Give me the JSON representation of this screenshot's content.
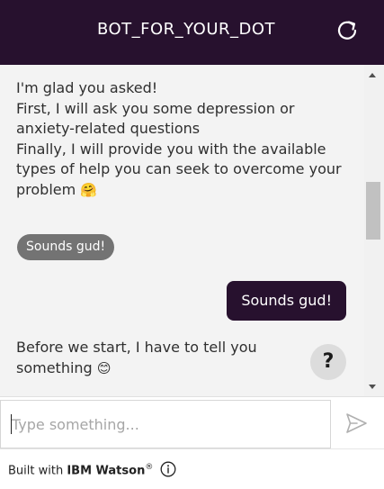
{
  "header": {
    "title": "BOT_FOR_YOUR_DOT",
    "restart_icon": "restart-icon"
  },
  "messages": {
    "bot_intro": {
      "line1": "I'm glad you asked!",
      "line2": "First, I will ask you some depression or",
      "line3": "anxiety-related questions",
      "line4": "Finally, I will provide you with the available",
      "line5": "types of help you can seek to overcome your",
      "line6": "problem",
      "emoji": "🤗"
    },
    "option_chip": "Sounds gud!",
    "user_reply": "Sounds gud!",
    "bot_followup": {
      "line1": "Before we start, I have to tell you",
      "line2": "something",
      "emoji": "😊"
    }
  },
  "help_button": {
    "label": "?"
  },
  "input": {
    "placeholder": "Type something...",
    "value": "",
    "send_icon": "send-icon"
  },
  "footer": {
    "prefix": "Built with ",
    "brand": "IBM Watson",
    "registered": "®",
    "info_icon": "info-icon"
  },
  "colors": {
    "header_bg": "#27112e",
    "user_bubble_bg": "#27112e",
    "chip_bg": "#737373",
    "chat_bg": "#f3f3f3"
  }
}
